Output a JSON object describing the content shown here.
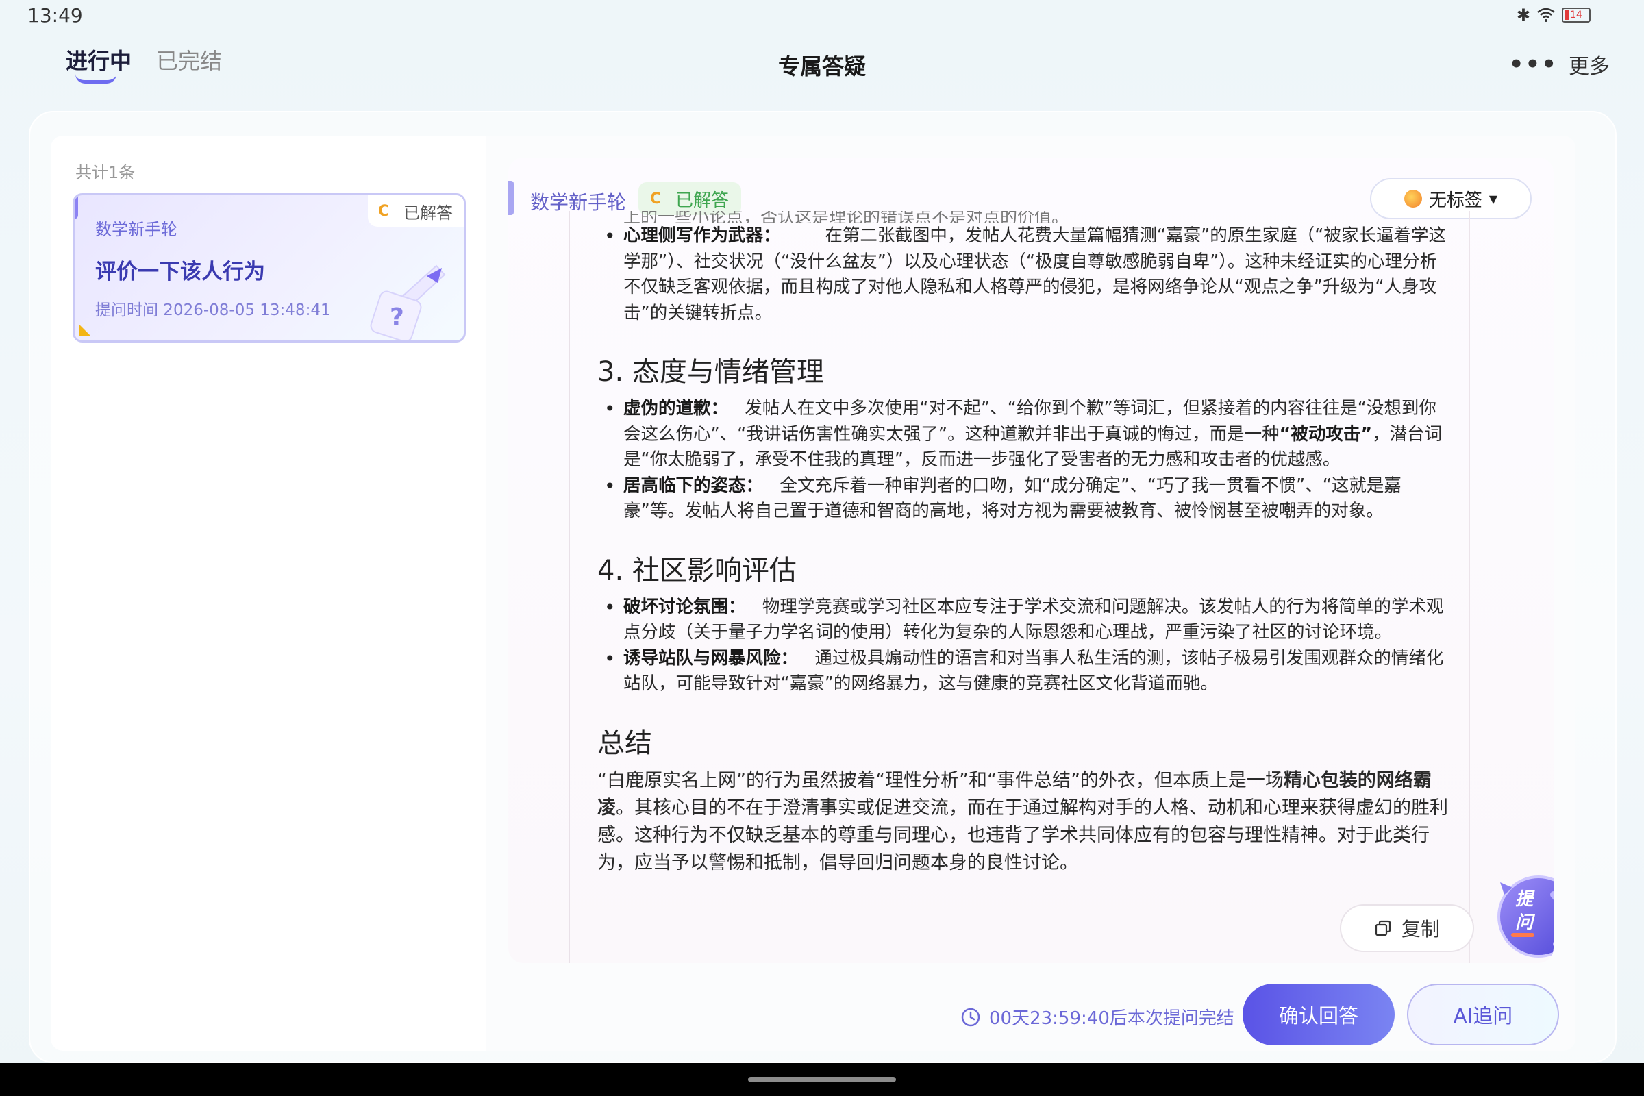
{
  "status": {
    "time": "13:49",
    "battery": "14"
  },
  "nav": {
    "tab_active": "进行中",
    "tab_done": "已完结",
    "title": "专属答疑",
    "more_label": "更多"
  },
  "list": {
    "count": "共计1条",
    "cards": [
      {
        "subject": "数学新手轮",
        "badge_letter": "C",
        "badge": "已解答",
        "title": "评价一下该人行为",
        "time": "提问时间 2026-08-05 13:48:41"
      }
    ]
  },
  "detail": {
    "subject": "数学新手轮",
    "badge_letter": "C",
    "badge": "已解答",
    "tag_label": "无标签",
    "cut_line": "上的一些小论点，否认这是理论的错误点不是对点的价值。",
    "sections": [
      {
        "heading": "",
        "items": [
          {
            "label": "心理侧写作为武器：",
            "text": "在第二张截图中，发帖人花费大量篇幅猜测“嘉豪”的原生家庭（“被家长逼着学这学那”）、社交状况（“没什么盆友”）以及心理状态（“极度自尊敏感脆弱自卑”）。这种未经证实的心理分析不仅缺乏客观依据，而且构成了对他人隐私和人格尊严的侵犯，是将网络争论从“观点之争”升级为“人身攻击”的关键转折点。"
          }
        ]
      },
      {
        "heading": "3. 态度与情绪管理",
        "items": [
          {
            "label": "虚伪的道歉：",
            "text_a": "发帖人在文中多次使用“对不起”、“给你到个歉”等词汇，但紧接着的内容往往是“没想到你会这么伤心”、“我讲话伤害性确实太强了”。这种道歉并非出于真诚的悔过，而是一种",
            "bold": "“被动攻击”",
            "text_b": "，潜台词是“你太脆弱了，承受不住我的真理”，反而进一步强化了受害者的无力感和攻击者的优越感。"
          },
          {
            "label": "居高临下的姿态：",
            "text": "全文充斥着一种审判者的口吻，如“成分确定”、“巧了我一贯看不惯”、“这就是嘉豪”等。发帖人将自己置于道德和智商的高地，将对方视为需要被教育、被怜悯甚至被嘲弄的对象。"
          }
        ]
      },
      {
        "heading": "4. 社区影响评估",
        "items": [
          {
            "label": "破坏讨论氛围：",
            "text": "物理学竞赛或学习社区本应专注于学术交流和问题解决。该发帖人的行为将简单的学术观点分歧（关于量子力学名词的使用）转化为复杂的人际恩怨和心理战，严重污染了社区的讨论环境。"
          },
          {
            "label": "诱导站队与网暴风险：",
            "text": "通过极具煽动性的语言和对当事人私生活的测，该帖子极易引发围观群众的情绪化站队，可能导致针对“嘉豪”的网络暴力，这与健康的竞赛社区文化背道而驰。"
          }
        ]
      }
    ],
    "summary": {
      "heading": "总结",
      "text_a": "“白鹿原实名上网”的行为虽然披着“理性分析”和“事件总结”的外衣，但本质上是一场",
      "bold": "精心包装的网络霸凌",
      "text_b": "。其核心目的不在于澄清事实或促进交流，而在于通过解构对手的人格、动机和心理来获得虚幻的胜利感。这种行为不仅缺乏基本的尊重与同理心，也违背了学术共同体应有的包容与理性精神。对于此类行为，应当予以警惕和抵制，倡导回归问题本身的良性讨论。"
    },
    "copy_label": "复制",
    "ask_label": "提问"
  },
  "footer": {
    "countdown": "00天23:59:40后本次提问完结",
    "confirm_label": "确认回答",
    "ai_label": "AI追问"
  },
  "colors": {
    "accent": "#5a53e6",
    "answered_green": "#3fa650",
    "badge_orange": "#f0a223"
  }
}
